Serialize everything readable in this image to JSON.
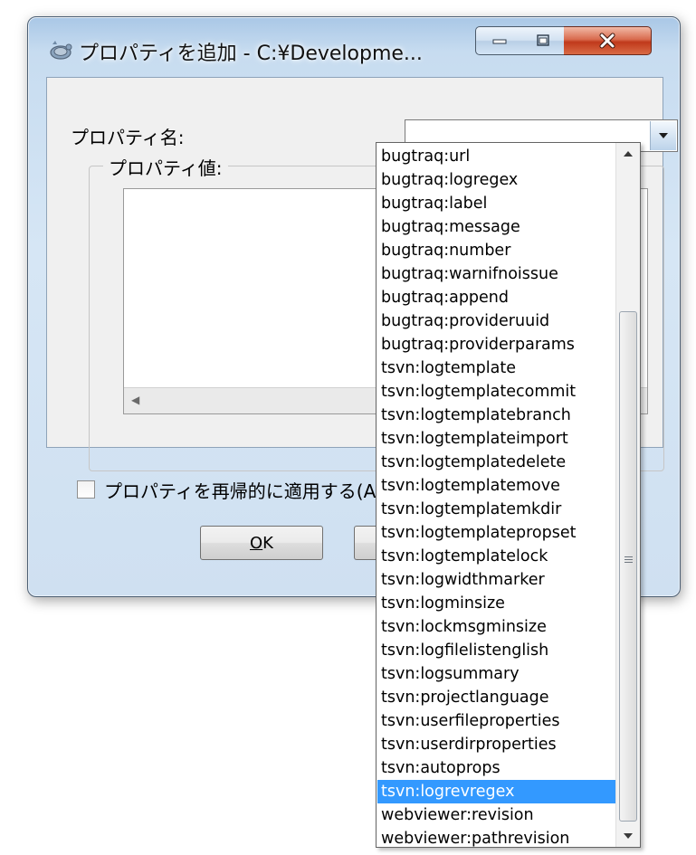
{
  "window": {
    "title": "プロパティを追加 - C:¥Developme...",
    "minimize_label": "minimize",
    "maximize_label": "maximize",
    "close_label": "close"
  },
  "form": {
    "property_name_label": "プロパティ名:",
    "property_name_value": "",
    "property_value_group_label": "プロパティ値:",
    "property_value_text": "",
    "recursive_checkbox_label": "プロパティを再帰的に適用する(A",
    "recursive_checked": false
  },
  "buttons": {
    "ok_label": "OK",
    "ok_mnemonic": "O",
    "cancel_label": ""
  },
  "dropdown": {
    "selected": "tsvn:logrevregex",
    "items": [
      "bugtraq:url",
      "bugtraq:logregex",
      "bugtraq:label",
      "bugtraq:message",
      "bugtraq:number",
      "bugtraq:warnifnoissue",
      "bugtraq:append",
      "bugtraq:provideruuid",
      "bugtraq:providerparams",
      "tsvn:logtemplate",
      "tsvn:logtemplatecommit",
      "tsvn:logtemplatebranch",
      "tsvn:logtemplateimport",
      "tsvn:logtemplatedelete",
      "tsvn:logtemplatemove",
      "tsvn:logtemplatemkdir",
      "tsvn:logtemplatepropset",
      "tsvn:logtemplatelock",
      "tsvn:logwidthmarker",
      "tsvn:logminsize",
      "tsvn:lockmsgminsize",
      "tsvn:logfilelistenglish",
      "tsvn:logsummary",
      "tsvn:projectlanguage",
      "tsvn:userfileproperties",
      "tsvn:userdirproperties",
      "tsvn:autoprops",
      "tsvn:logrevregex",
      "webviewer:revision",
      "webviewer:pathrevision"
    ]
  },
  "colors": {
    "selection": "#3399ff",
    "window_frame": "#c7dcf0",
    "close_button": "#c0391b"
  }
}
